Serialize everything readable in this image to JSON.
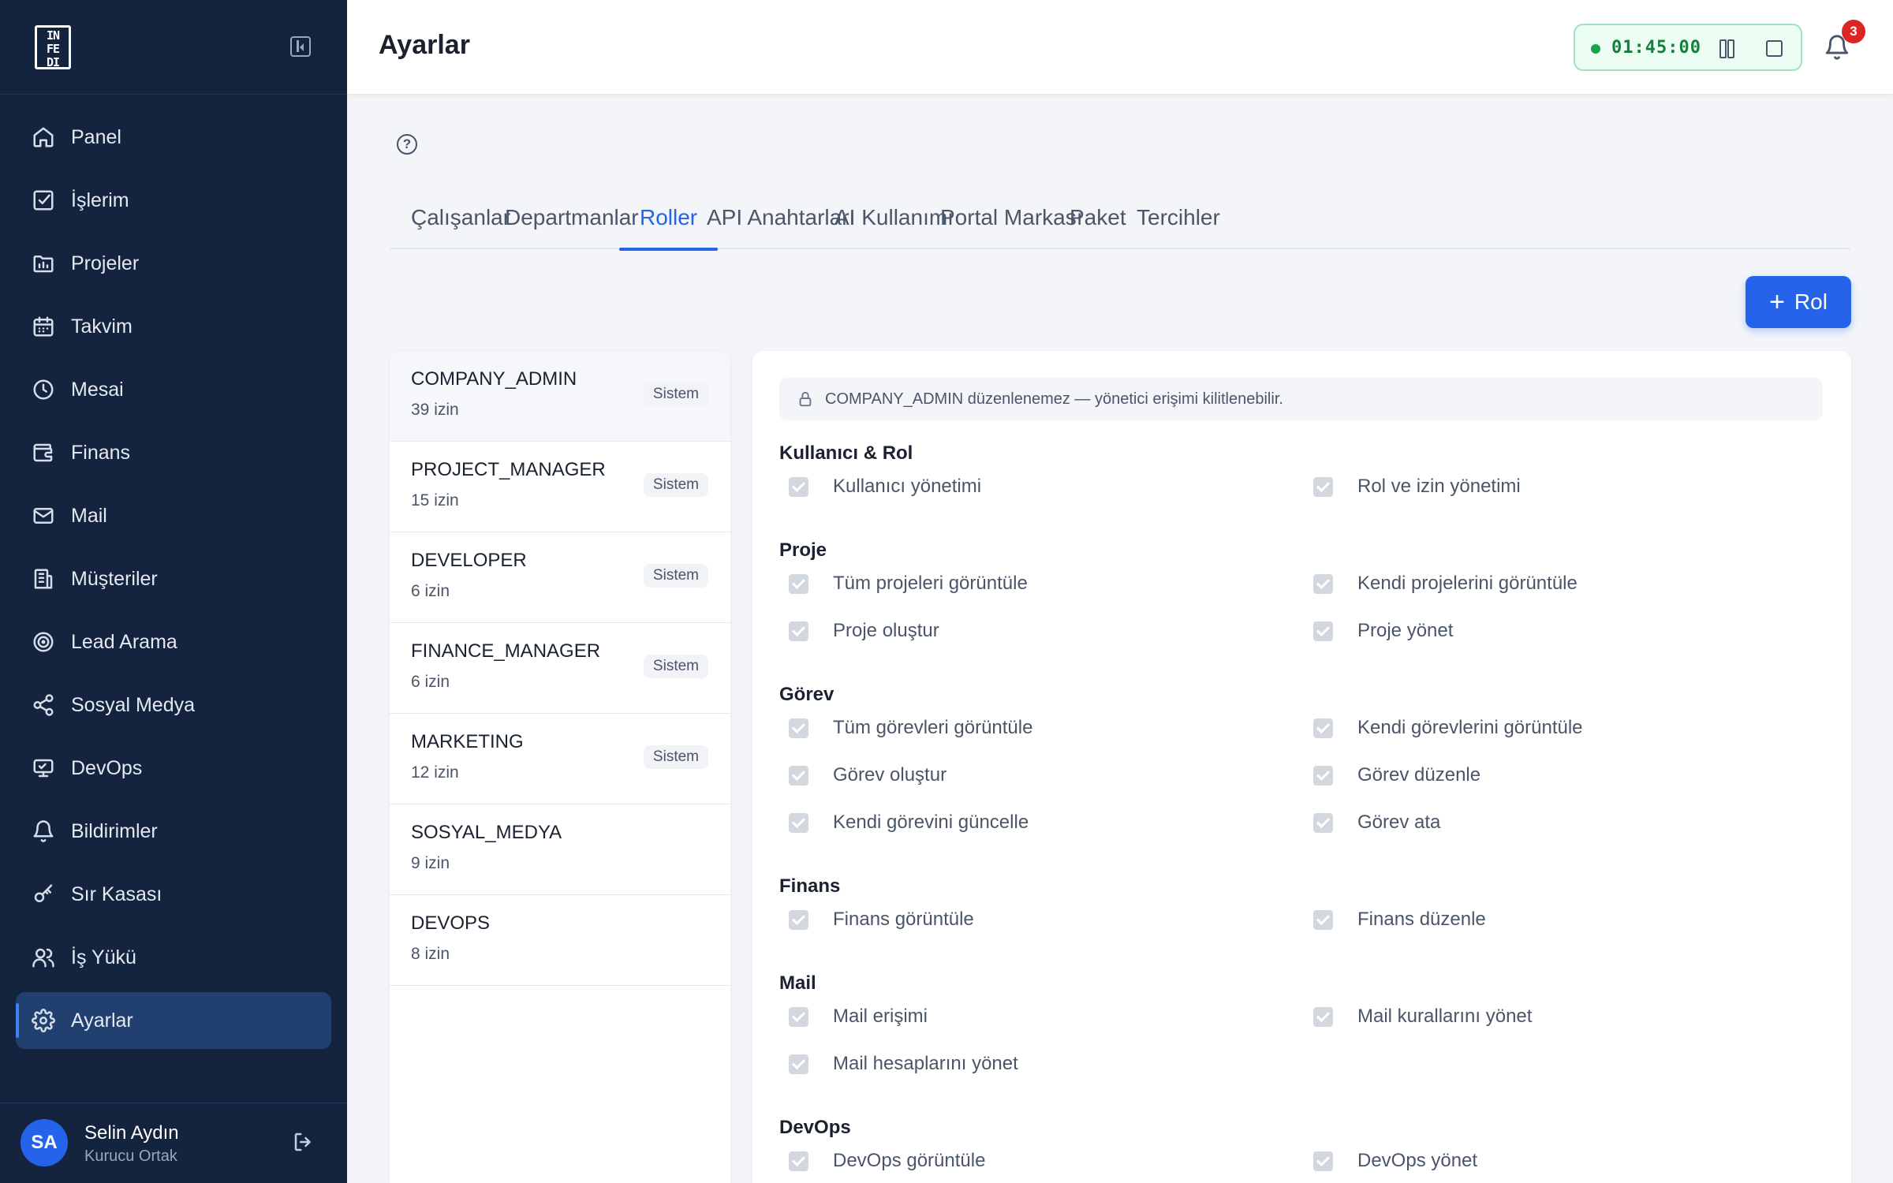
{
  "app": {
    "logo_text": "IN\nFE\nDI"
  },
  "sidebar": {
    "items": [
      {
        "label": "Panel",
        "icon": "home-icon"
      },
      {
        "label": "İşlerim",
        "icon": "checkbox-icon"
      },
      {
        "label": "Projeler",
        "icon": "folder-chart-icon"
      },
      {
        "label": "Takvim",
        "icon": "calendar-icon"
      },
      {
        "label": "Mesai",
        "icon": "clock-icon"
      },
      {
        "label": "Finans",
        "icon": "wallet-icon"
      },
      {
        "label": "Mail",
        "icon": "mail-icon"
      },
      {
        "label": "Müşteriler",
        "icon": "building-icon"
      },
      {
        "label": "Lead Arama",
        "icon": "target-icon"
      },
      {
        "label": "Sosyal Medya",
        "icon": "share-icon"
      },
      {
        "label": "DevOps",
        "icon": "monitor-icon"
      },
      {
        "label": "Bildirimler",
        "icon": "bell-icon"
      },
      {
        "label": "Sır Kasası",
        "icon": "key-icon"
      },
      {
        "label": "İş Yükü",
        "icon": "users-icon"
      },
      {
        "label": "Ayarlar",
        "icon": "gear-icon",
        "active": true
      }
    ],
    "user": {
      "initials": "SA",
      "name": "Selin Aydın",
      "role": "Kurucu Ortak"
    }
  },
  "header": {
    "title": "Ayarlar",
    "timer": "01:45:00",
    "notification_count": "3"
  },
  "tabs": [
    "Çalışanlar",
    "Departmanlar",
    "Roller",
    "API Anahtarları",
    "AI Kullanımı",
    "Portal Markası",
    "Paket",
    "Tercihler"
  ],
  "active_tab": "Roller",
  "add_role_label": "Rol",
  "roles": [
    {
      "name": "COMPANY_ADMIN",
      "count": "39 izin",
      "badge": "Sistem",
      "active": true
    },
    {
      "name": "PROJECT_MANAGER",
      "count": "15 izin",
      "badge": "Sistem"
    },
    {
      "name": "DEVELOPER",
      "count": "6 izin",
      "badge": "Sistem"
    },
    {
      "name": "FINANCE_MANAGER",
      "count": "6 izin",
      "badge": "Sistem"
    },
    {
      "name": "MARKETING",
      "count": "12 izin",
      "badge": "Sistem"
    },
    {
      "name": "SOSYAL_MEDYA",
      "count": "9 izin",
      "badge": ""
    },
    {
      "name": "DEVOPS",
      "count": "8 izin",
      "badge": ""
    }
  ],
  "notice": "COMPANY_ADMIN düzenlenemez — yönetici erişimi kilitlenebilir.",
  "permission_groups": [
    {
      "title": "Kullanıcı & Rol",
      "items": [
        "Kullanıcı yönetimi",
        "Rol ve izin yönetimi"
      ]
    },
    {
      "title": "Proje",
      "items": [
        "Tüm projeleri görüntüle",
        "Kendi projelerini görüntüle",
        "Proje oluştur",
        "Proje yönet"
      ]
    },
    {
      "title": "Görev",
      "items": [
        "Tüm görevleri görüntüle",
        "Kendi görevlerini görüntüle",
        "Görev oluştur",
        "Görev düzenle",
        "Kendi görevini güncelle",
        "Görev ata"
      ]
    },
    {
      "title": "Finans",
      "items": [
        "Finans görüntüle",
        "Finans düzenle"
      ]
    },
    {
      "title": "Mail",
      "items": [
        "Mail erişimi",
        "Mail kurallarını yönet",
        "Mail hesaplarını yönet"
      ]
    },
    {
      "title": "DevOps",
      "items": [
        "DevOps görüntüle",
        "DevOps yönet"
      ]
    }
  ]
}
